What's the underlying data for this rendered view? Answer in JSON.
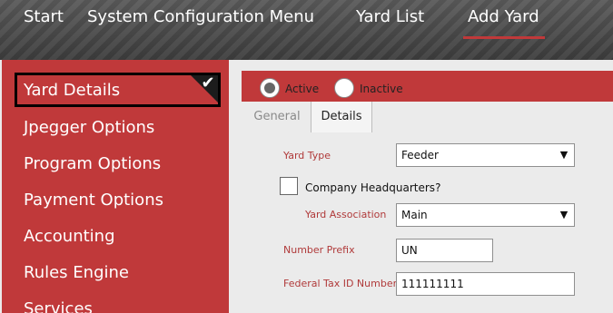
{
  "nav": {
    "items": [
      {
        "label": "Start"
      },
      {
        "label": "System Configuration Menu"
      },
      {
        "label": "Yard List"
      },
      {
        "label": "Add Yard"
      }
    ],
    "active_index": 3,
    "accent_color": "#c0393a"
  },
  "sidebar": {
    "active_label": "Yard Details",
    "active_icon": "check-icon",
    "items": [
      {
        "label": "Jpegger Options"
      },
      {
        "label": "Program Options"
      },
      {
        "label": "Payment Options"
      },
      {
        "label": "Accounting"
      },
      {
        "label": "Rules Engine"
      },
      {
        "label": "Services"
      }
    ],
    "background_color": "#c0393a"
  },
  "status": {
    "options": [
      {
        "label": "Active",
        "selected": true
      },
      {
        "label": "Inactive",
        "selected": false
      }
    ]
  },
  "tabs": [
    {
      "label": "General",
      "active": false
    },
    {
      "label": "Details",
      "active": true
    }
  ],
  "form": {
    "yard_type": {
      "label": "Yard Type",
      "value": "Feeder"
    },
    "company_hq": {
      "label": "Company Headquarters?",
      "checked": false
    },
    "yard_association": {
      "label": "Yard Association",
      "value": "Main"
    },
    "number_prefix": {
      "label": "Number Prefix",
      "value": "UN"
    },
    "federal_tax_id": {
      "label": "Federal Tax ID Number",
      "value": "111111111"
    }
  }
}
